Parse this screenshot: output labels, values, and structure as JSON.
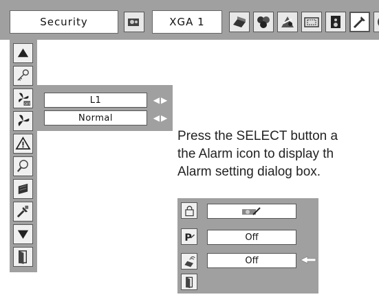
{
  "topbar": {
    "menu_title": "Security",
    "input_label": "XGA 1",
    "icons": [
      "input-icon",
      "pc-adjust-icon",
      "image-select-icon",
      "image-adjust-icon",
      "screen-icon",
      "sound-icon",
      "setting-icon",
      "info-icon"
    ]
  },
  "sidebar": {
    "icons": [
      "move-up-icon",
      "key-icon",
      "fan-off-icon",
      "fan-icon",
      "warning-icon",
      "lamp-icon",
      "filter-icon",
      "settings-wrench-icon",
      "move-down-icon",
      "exit-icon"
    ]
  },
  "submenu": {
    "level_value": "L1",
    "mode_value": "Normal"
  },
  "caption": {
    "text": "Press the SELECT button a\nthe Alarm icon to display th\nAlarm setting dialog box."
  },
  "dialog": {
    "rows": [
      {
        "icon": "lock-icon",
        "value": ""
      },
      {
        "icon": "pin-code-icon",
        "value": "Off"
      },
      {
        "icon": "alarm-sensor-icon",
        "value": "Off"
      },
      {
        "icon": "exit-icon",
        "value": null
      }
    ]
  },
  "colors": {
    "panel_gray": "#a0a0a0",
    "field_white": "#ffffff",
    "arrow_white": "#ffffff"
  }
}
